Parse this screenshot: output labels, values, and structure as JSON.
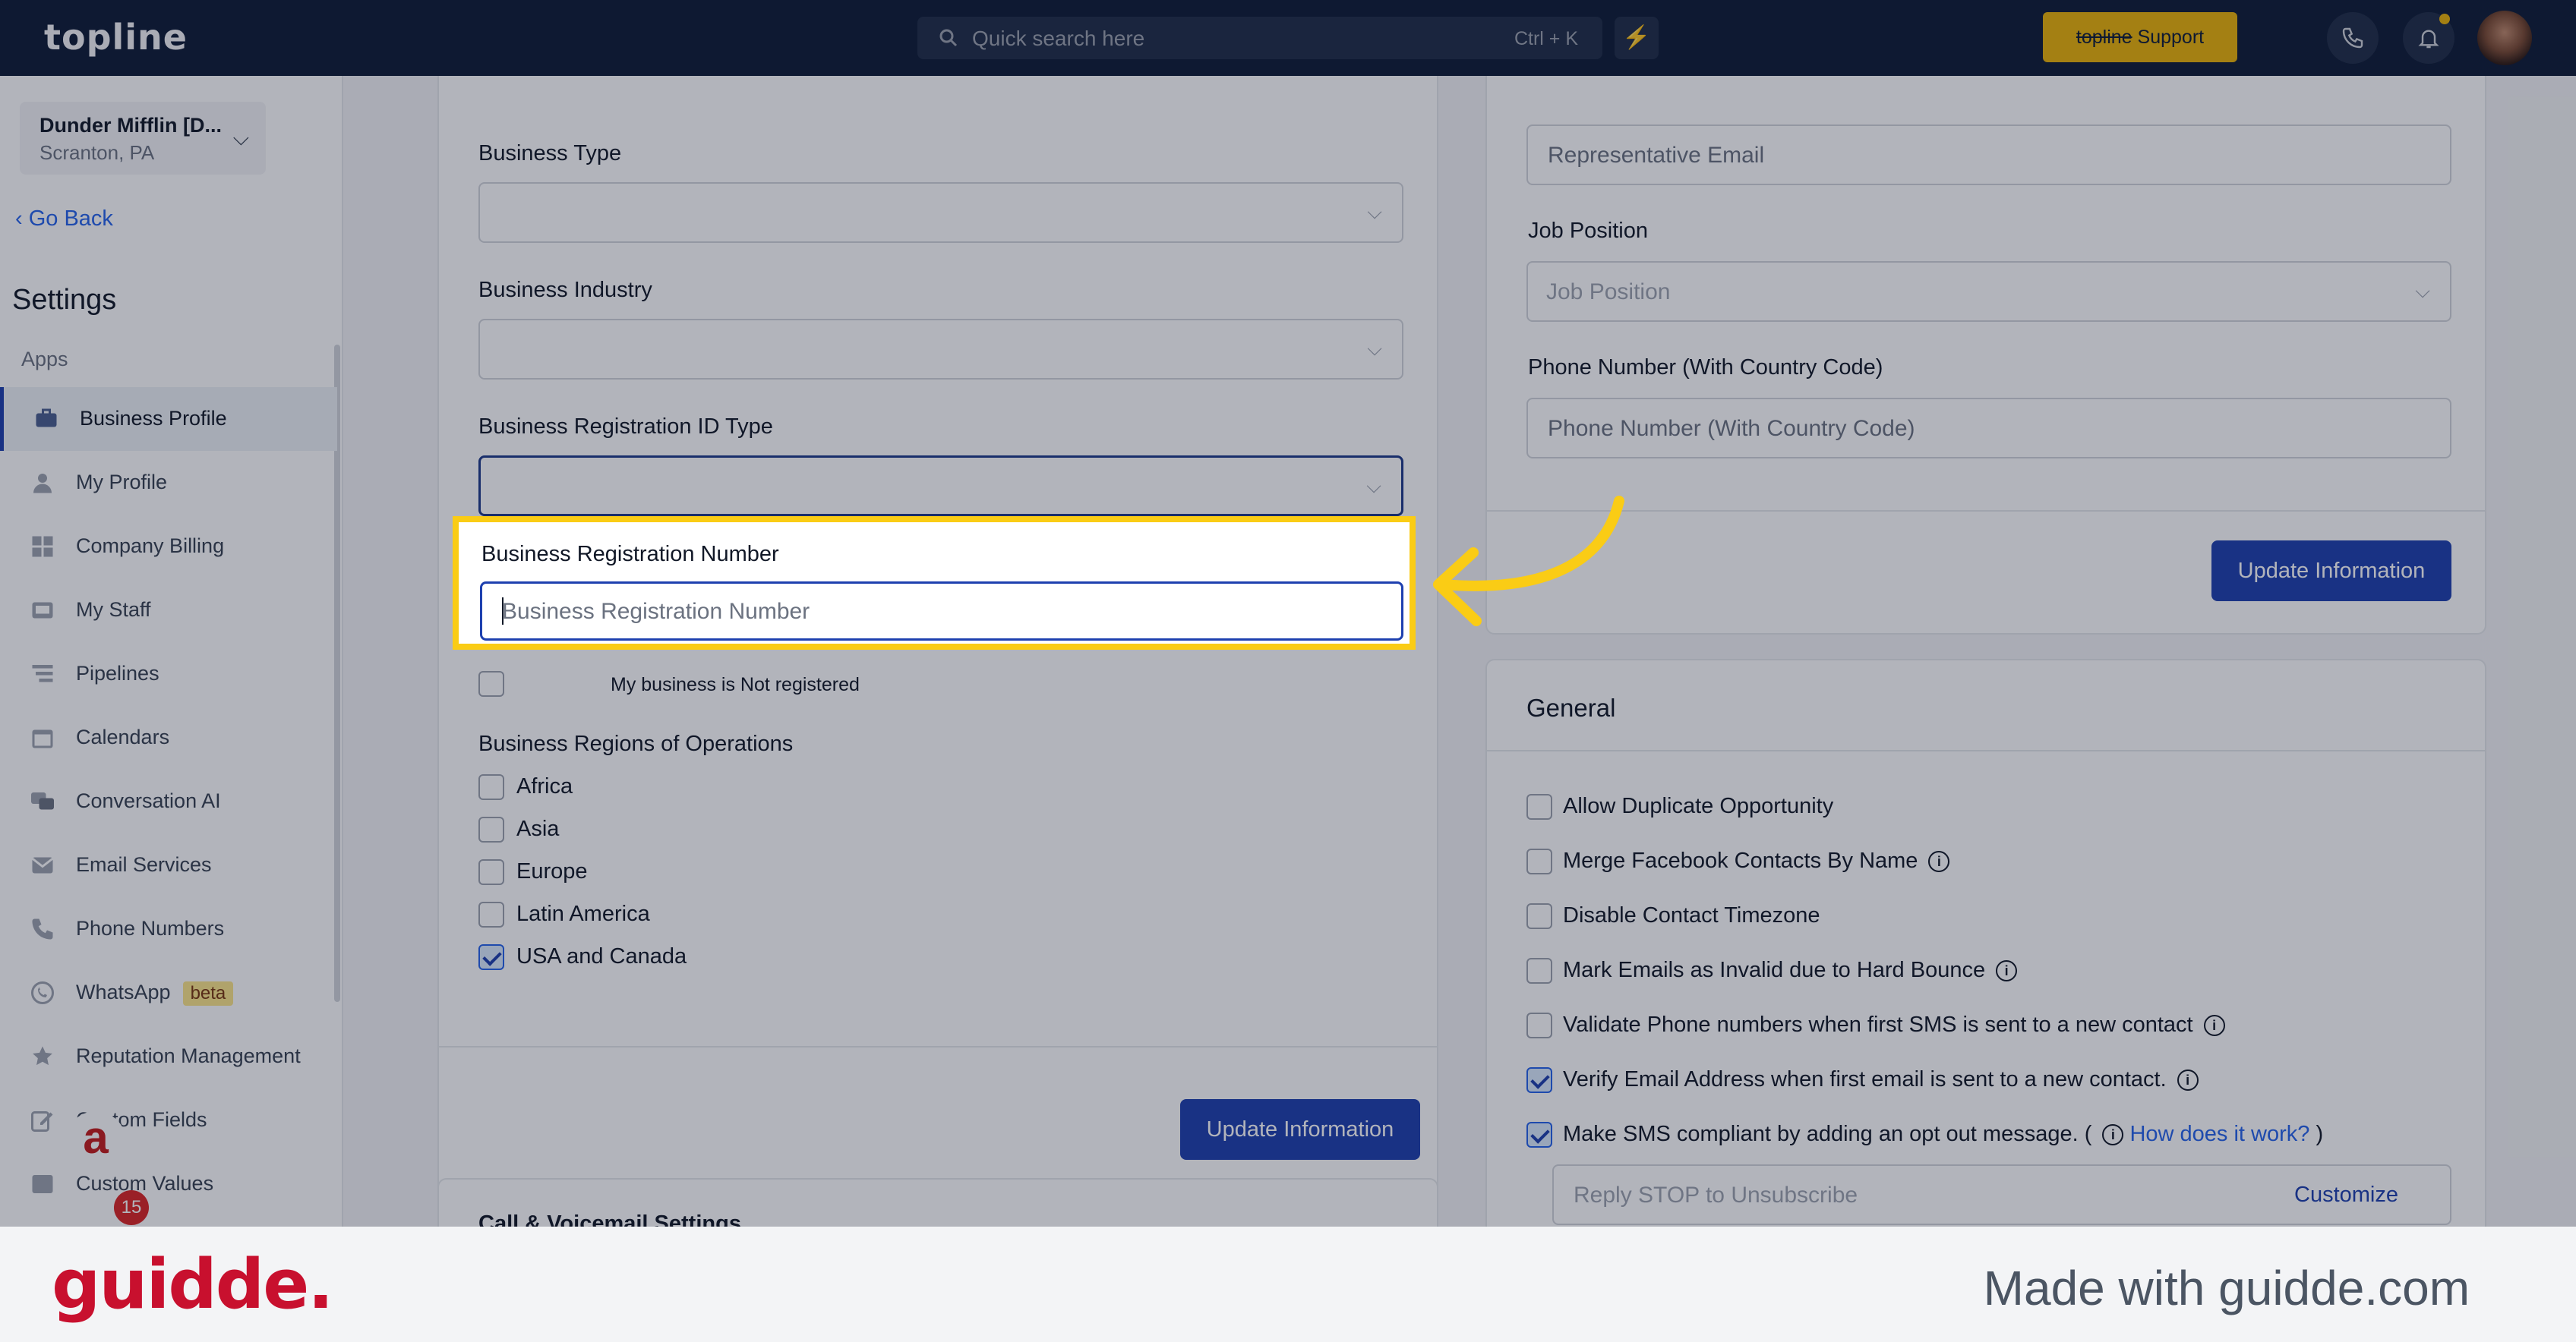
{
  "topbar": {
    "logo": "topline",
    "search_placeholder": "Quick search here",
    "search_shortcut": "Ctrl + K",
    "support_brand": "topline",
    "support_label": " Support"
  },
  "sidebar": {
    "location_name": "Dunder Mifflin [D...",
    "location_city": "Scranton, PA",
    "go_back": "Go Back",
    "settings_title": "Settings",
    "section_label": "Apps",
    "items": [
      {
        "label": "Business Profile",
        "icon": "briefcase-icon"
      },
      {
        "label": "My Profile",
        "icon": "user-icon"
      },
      {
        "label": "Company Billing",
        "icon": "billing-icon"
      },
      {
        "label": "My Staff",
        "icon": "staff-icon"
      },
      {
        "label": "Pipelines",
        "icon": "pipeline-icon"
      },
      {
        "label": "Calendars",
        "icon": "calendar-icon"
      },
      {
        "label": "Conversation AI",
        "icon": "chat-icon"
      },
      {
        "label": "Email Services",
        "icon": "mail-icon"
      },
      {
        "label": "Phone Numbers",
        "icon": "phone-icon"
      },
      {
        "label": "WhatsApp",
        "icon": "whatsapp-icon",
        "badge": "beta"
      },
      {
        "label": "Reputation Management",
        "icon": "star-icon"
      },
      {
        "label": "Custom Fields",
        "icon": "edit-icon"
      },
      {
        "label": "Custom Values",
        "icon": "values-icon"
      }
    ],
    "notification_count": "15",
    "widget_letter": "a"
  },
  "business_info": {
    "business_type_label": "Business Type",
    "business_industry_label": "Business Industry",
    "registration_id_type_label": "Business Registration ID Type",
    "registration_number_label": "Business Registration Number",
    "registration_number_placeholder": "Business Registration Number",
    "not_registered_label": "My business is Not registered",
    "regions_label": "Business Regions of Operations",
    "regions": [
      {
        "label": "Africa",
        "checked": false
      },
      {
        "label": "Asia",
        "checked": false
      },
      {
        "label": "Europe",
        "checked": false
      },
      {
        "label": "Latin America",
        "checked": false
      },
      {
        "label": "USA and Canada",
        "checked": true
      }
    ],
    "update_button": "Update Information",
    "next_section_title": "Call & Voicemail Settings"
  },
  "representative": {
    "email_placeholder": "Representative Email",
    "job_position_label": "Job Position",
    "job_position_placeholder": "Job Position",
    "phone_label": "Phone Number (With Country Code)",
    "phone_placeholder": "Phone Number (With Country Code)",
    "update_button": "Update Information"
  },
  "general": {
    "title": "General",
    "options": [
      {
        "label": "Allow Duplicate Opportunity",
        "checked": false,
        "info": false
      },
      {
        "label": "Merge Facebook Contacts By Name",
        "checked": false,
        "info": true
      },
      {
        "label": "Disable Contact Timezone",
        "checked": false,
        "info": false
      },
      {
        "label": "Mark Emails as Invalid due to Hard Bounce",
        "checked": false,
        "info": true
      },
      {
        "label": "Validate Phone numbers when first SMS is sent to a new contact",
        "checked": false,
        "info": true
      },
      {
        "label": "Verify Email Address when first email is sent to a new contact.",
        "checked": true,
        "info": true
      },
      {
        "label": "Make SMS compliant by adding an opt out message.",
        "checked": true,
        "info": false
      }
    ],
    "how_link": "How does it work?",
    "paren_open": "(",
    "paren_close": ")",
    "optout_placeholder": "Reply STOP to Unsubscribe",
    "customize": "Customize"
  },
  "footer": {
    "brand": "guidde.",
    "made_with": "Made with guidde.com"
  },
  "colors": {
    "topbar_bg": "#0e1b35",
    "accent_blue": "#1e40af",
    "highlight_yellow": "#facc15",
    "support_yellow": "#eab308",
    "guidde_red": "#c8102e"
  }
}
